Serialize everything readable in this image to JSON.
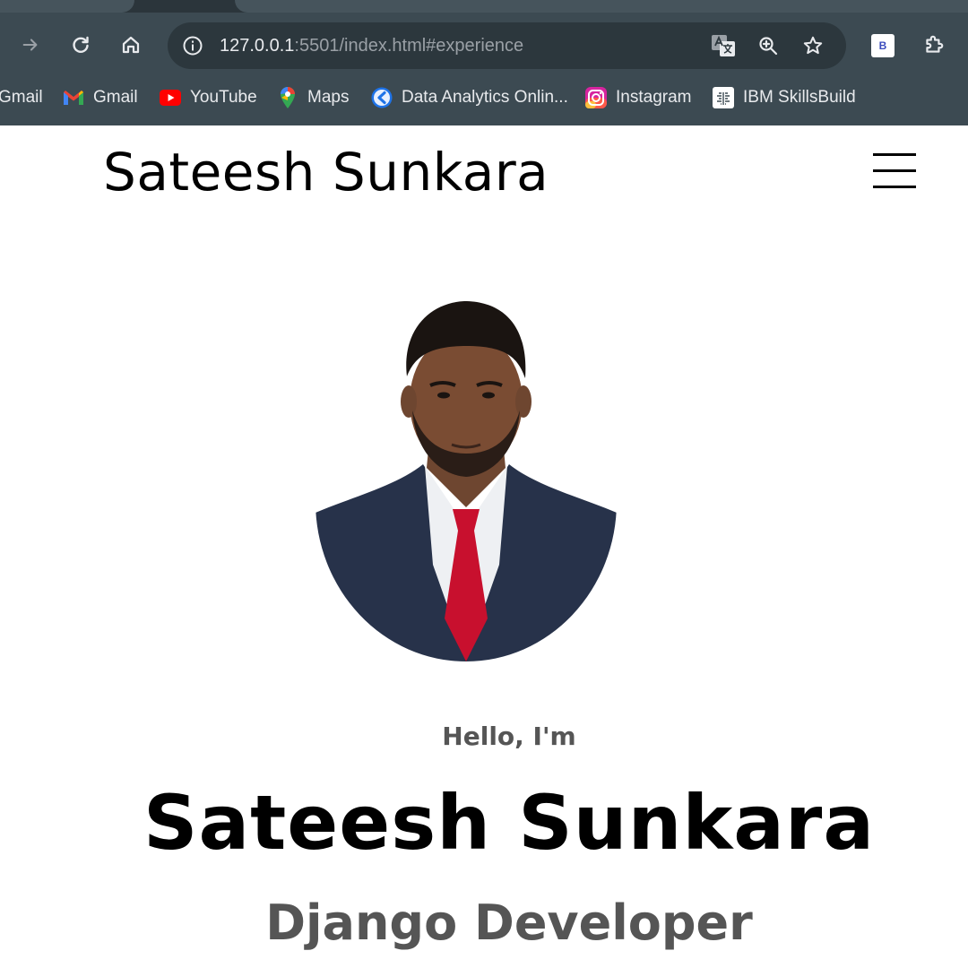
{
  "browser": {
    "url_host": "127.0.0.1",
    "url_rest": ":5501/index.html#experience",
    "extension_badge": "B",
    "bookmarks": [
      {
        "label": "Gmail",
        "icon": "none"
      },
      {
        "label": "Gmail",
        "icon": "gmail-icon"
      },
      {
        "label": "YouTube",
        "icon": "youtube-icon"
      },
      {
        "label": "Maps",
        "icon": "maps-icon"
      },
      {
        "label": "Data Analytics Onlin...",
        "icon": "data-analytics-icon"
      },
      {
        "label": "Instagram",
        "icon": "instagram-icon"
      },
      {
        "label": "IBM SkillsBuild",
        "icon": "ibm-skillsbuild-icon"
      }
    ]
  },
  "header": {
    "site_name": "Sateesh Sunkara"
  },
  "hero": {
    "greeting": "Hello, I'm",
    "name": "Sateesh Sunkara",
    "role": "Django Developer"
  },
  "colors": {
    "chrome_bg": "#3c4a52",
    "omnibox_bg": "#2c373d",
    "page_bg": "#ffffff",
    "heading": "#000000",
    "muted_text": "#555555",
    "suit": "#27324a",
    "tie": "#c8102e"
  }
}
